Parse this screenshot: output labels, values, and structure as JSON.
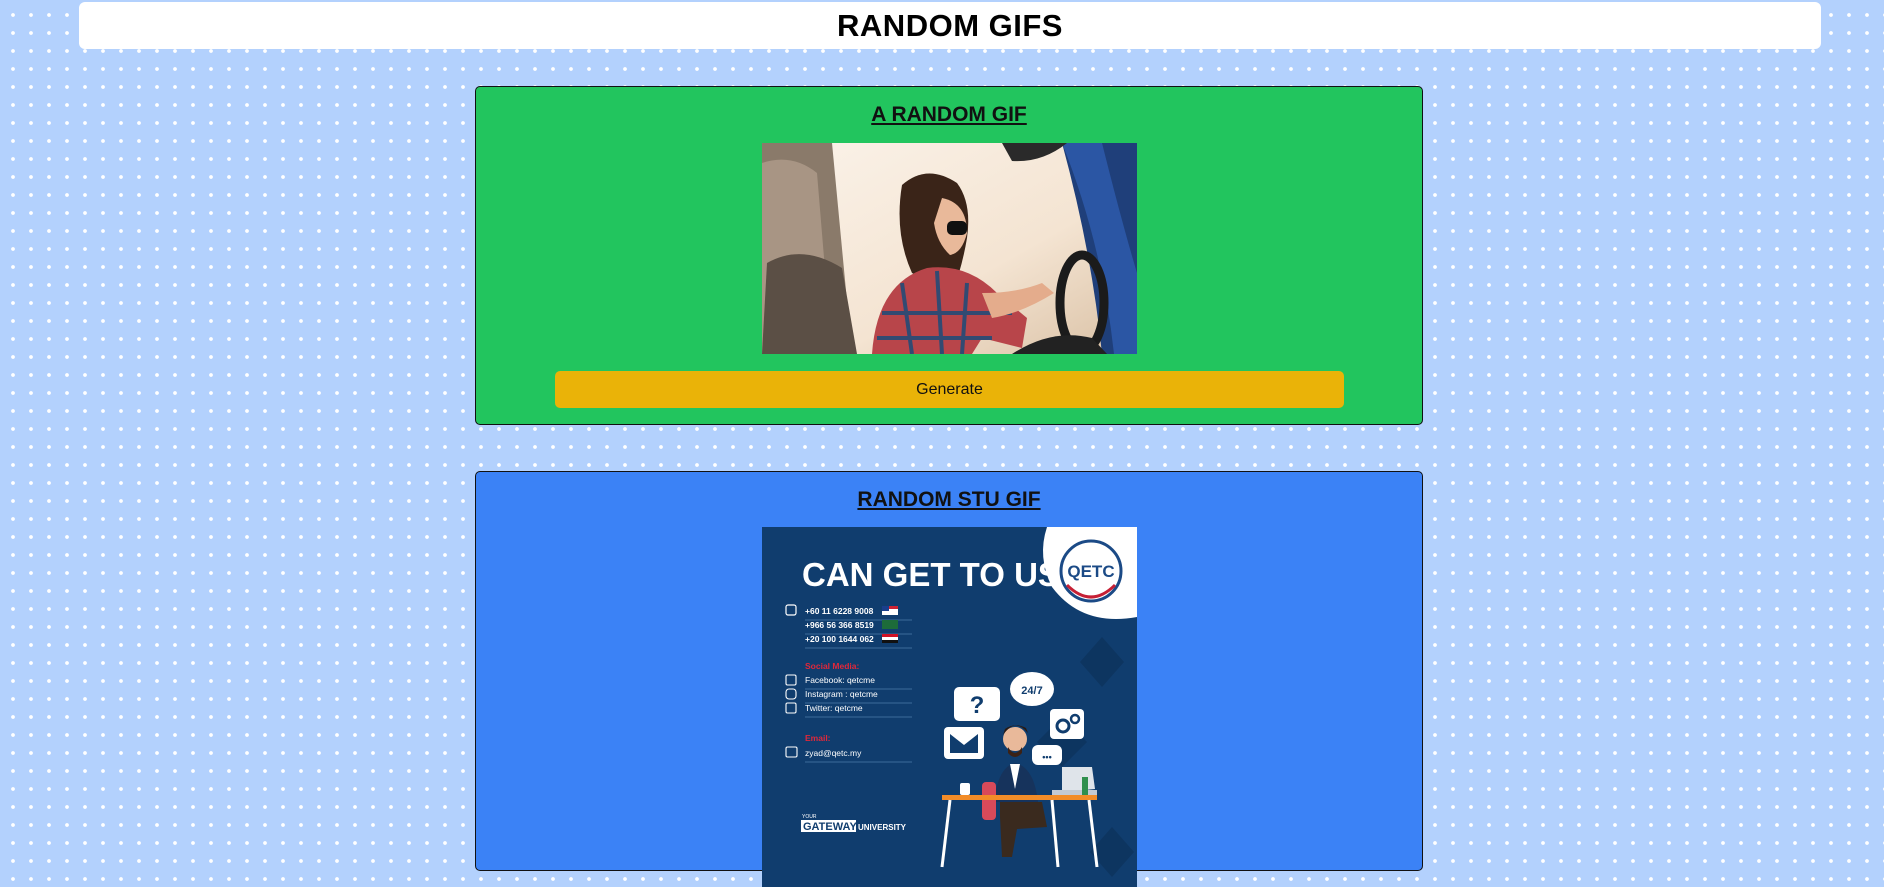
{
  "header": {
    "title": "RANDOM GIFS"
  },
  "random_gif": {
    "title": "A RANDOM GIF",
    "generate_label": "Generate"
  },
  "stu_gif": {
    "title": "RANDOM STU GIF",
    "poster": {
      "headline": "CAN GET TO US",
      "logo_text": "QETC",
      "phone_1": "+60 11 6228 9008",
      "phone_2": "+966 56 366 8519",
      "phone_3": "+20 100 1644 062",
      "social_heading": "Social Media:",
      "facebook": "Facebook:    qetcme",
      "instagram": "Instagram :  qetcme",
      "twitter": "Twitter:       qetcme",
      "email_heading": "Email:",
      "email": "zyad@qetc.my",
      "gateway_prefix": "YOUR",
      "gateway": "GATEWAY",
      "university": "UNIVERSITY",
      "bubble_question": "?",
      "bubble_247": "24/7",
      "bubble_dots": "•••"
    }
  },
  "colors": {
    "background": "#b3d1fd",
    "header_bg": "#ffffff",
    "card_green": "#22c55e",
    "card_blue": "#3b82f6",
    "button_yellow": "#eab308",
    "poster_navy": "#103d6e"
  }
}
